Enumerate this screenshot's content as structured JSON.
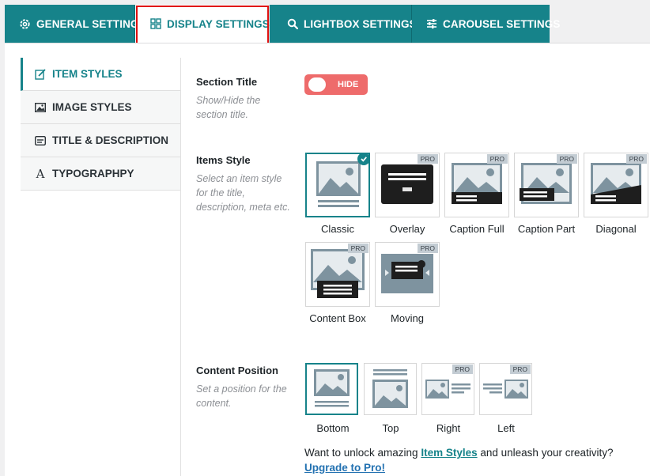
{
  "tabs": {
    "general": "GENERAL SETTINGS",
    "display": "DISPLAY SETTINGS",
    "lightbox": "LIGHTBOX SETTINGS",
    "carousel": "CAROUSEL SETTINGS",
    "active": "display"
  },
  "sidebar": {
    "items": [
      {
        "label": "ITEM STYLES",
        "icon": "edit-icon",
        "active": true
      },
      {
        "label": "IMAGE STYLES",
        "icon": "image-icon",
        "active": false
      },
      {
        "label": "TITLE & DESCRIPTION",
        "icon": "caption-icon",
        "active": false
      },
      {
        "label": "TYPOGRAPHPY",
        "icon": "font-icon",
        "active": false
      }
    ]
  },
  "section_title": {
    "label": "Section Title",
    "desc": "Show/Hide the section title.",
    "toggle_text": "HIDE"
  },
  "items_style": {
    "label": "Items Style",
    "desc": "Select an item style for the title, description, meta etc.",
    "pro_badge": "PRO",
    "options": [
      "Classic",
      "Overlay",
      "Caption Full",
      "Caption Part",
      "Diagonal",
      "Content Box",
      "Moving"
    ],
    "selected": "Classic"
  },
  "content_position": {
    "label": "Content Position",
    "desc": "Set a position for the content.",
    "options": [
      "Bottom",
      "Top",
      "Right",
      "Left"
    ],
    "selected": "Bottom"
  },
  "promo": {
    "text_before": "Want to unlock amazing ",
    "link": "Item Styles",
    "text_after": " and unleash your creativity?",
    "upgrade": "Upgrade to Pro!"
  },
  "colors": {
    "accent": "#16838a",
    "toggle_off": "#ee6b6b",
    "highlight": "#e01010",
    "pro_badge": "#c3ccd3"
  }
}
